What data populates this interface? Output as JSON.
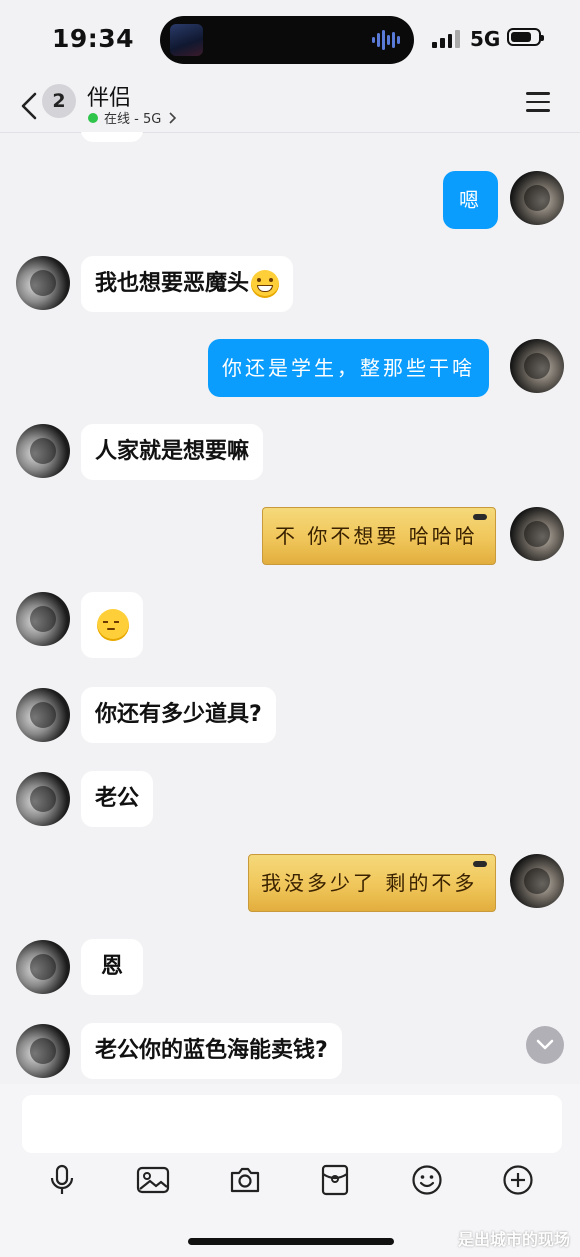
{
  "status": {
    "time": "19:34",
    "network": "5G"
  },
  "nav": {
    "unread_count": "2",
    "contact_name": "伴侣",
    "presence": "在线 - 5G"
  },
  "messages": [
    {
      "side": "out",
      "text": "嗯"
    },
    {
      "side": "in",
      "text": "我也想要恶魔头",
      "emoji": "grinning-face"
    },
    {
      "side": "out",
      "text": "你还是学生，整那些干啥"
    },
    {
      "side": "in",
      "text": "人家就是想要嘛"
    },
    {
      "side": "out",
      "style": "gold",
      "text": "不 你不想要 哈哈哈"
    },
    {
      "side": "in",
      "text": "",
      "emoji": "pensive-face"
    },
    {
      "side": "in",
      "text": "你还有多少道具?"
    },
    {
      "side": "in",
      "text": "老公"
    },
    {
      "side": "out",
      "style": "gold",
      "text": "我没多少了 剩的不多"
    },
    {
      "side": "in",
      "text": "恩"
    },
    {
      "side": "in",
      "text": "老公你的蓝色海能卖钱?"
    }
  ],
  "input": {
    "value": "",
    "placeholder": ""
  },
  "toolbar": [
    "microphone-icon",
    "image-icon",
    "camera-icon",
    "red-packet-icon",
    "emoji-icon",
    "plus-icon"
  ],
  "watermark": "是出城市的现场",
  "colors": {
    "outgoing_bubble": "#0a9dfe",
    "incoming_bubble": "#ffffff",
    "online_dot": "#2fc44a",
    "background": "#f2f2f4"
  }
}
